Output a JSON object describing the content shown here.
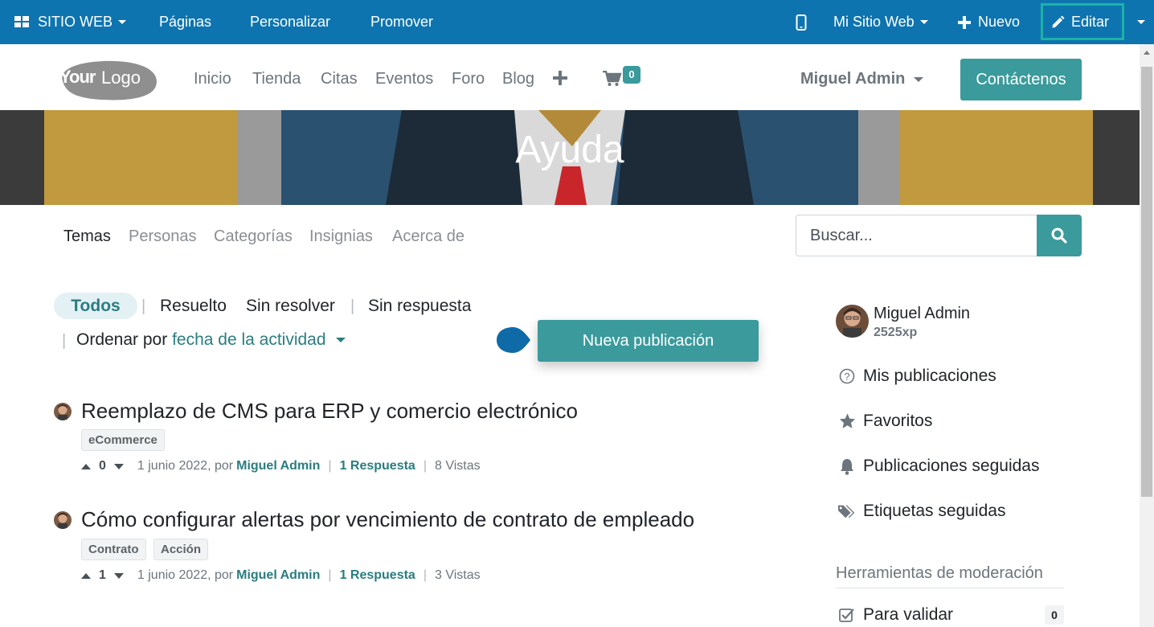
{
  "admin_bar": {
    "website_menu": "SITIO WEB",
    "pages": "Páginas",
    "customize": "Personalizar",
    "promote": "Promover",
    "my_website": "Mi Sitio Web",
    "new": "Nuevo",
    "edit": "Editar"
  },
  "site_nav": {
    "logo_text": "YourLogo",
    "items": [
      "Inicio",
      "Tienda",
      "Citas",
      "Eventos",
      "Foro",
      "Blog"
    ],
    "cart_count": "0",
    "user": "Miguel Admin",
    "contact_button": "Contáctenos"
  },
  "banner": {
    "title": "Ayuda"
  },
  "forum_nav": {
    "tabs": [
      "Temas",
      "Personas",
      "Categorías",
      "Insignias",
      "Acerca de"
    ],
    "search_placeholder": "Buscar..."
  },
  "filters": {
    "all": "Todos",
    "solved": "Resuelto",
    "unsolved": "Sin resolver",
    "unanswered": "Sin respuesta",
    "sort_label": "Ordenar por",
    "sort_value": "fecha de la actividad",
    "new_post_button": "Nueva publicación"
  },
  "posts": [
    {
      "title": "Reemplazo de CMS para ERP y comercio electrónico",
      "tags": [
        "eCommerce"
      ],
      "votes": "0",
      "date": "1 junio 2022, por",
      "author": "Miguel Admin",
      "answers": "1 Respuesta",
      "views": "8 Vistas"
    },
    {
      "title": "Cómo configurar alertas por vencimiento de contrato de empleado",
      "tags": [
        "Contrato",
        "Acción"
      ],
      "votes": "1",
      "date": "1 junio 2022, por",
      "author": "Miguel Admin",
      "answers": "1 Respuesta",
      "views": "3 Vistas"
    }
  ],
  "sidebar": {
    "user_name": "Miguel Admin",
    "xp": "2525xp",
    "links": [
      "Mis publicaciones",
      "Favoritos",
      "Publicaciones seguidas",
      "Etiquetas seguidas"
    ],
    "moderation_title": "Herramientas de moderación",
    "to_validate": "Para validar",
    "to_validate_count": "0"
  },
  "colors": {
    "admin_bar": "#0e74b0",
    "accent": "#3a9a9c",
    "edit_highlight": "#1ab3a6"
  }
}
